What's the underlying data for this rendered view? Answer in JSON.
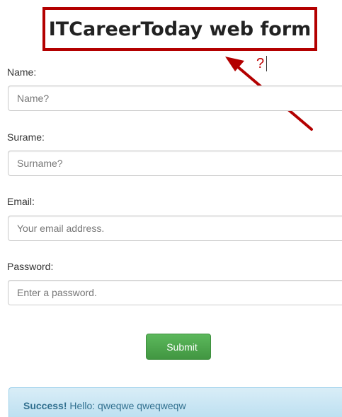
{
  "window": {
    "title": "ITCareerToday web form"
  },
  "annotation": {
    "question_mark": "?",
    "color": "#b30000"
  },
  "form": {
    "name": {
      "label": "Name:",
      "placeholder": "Name?",
      "value": ""
    },
    "surname": {
      "label": "Surame:",
      "placeholder": "Surname?",
      "value": ""
    },
    "email": {
      "label": "Email:",
      "placeholder": "Your email address.",
      "value": ""
    },
    "password": {
      "label": "Password:",
      "placeholder": "Enter a password.",
      "value": ""
    },
    "submit_label": "Submit",
    "submit_color": "#5cb85c"
  },
  "alert": {
    "strong": "Success!",
    "message": " Hello: qweqwe qweqweqw",
    "color": "#31708f"
  }
}
